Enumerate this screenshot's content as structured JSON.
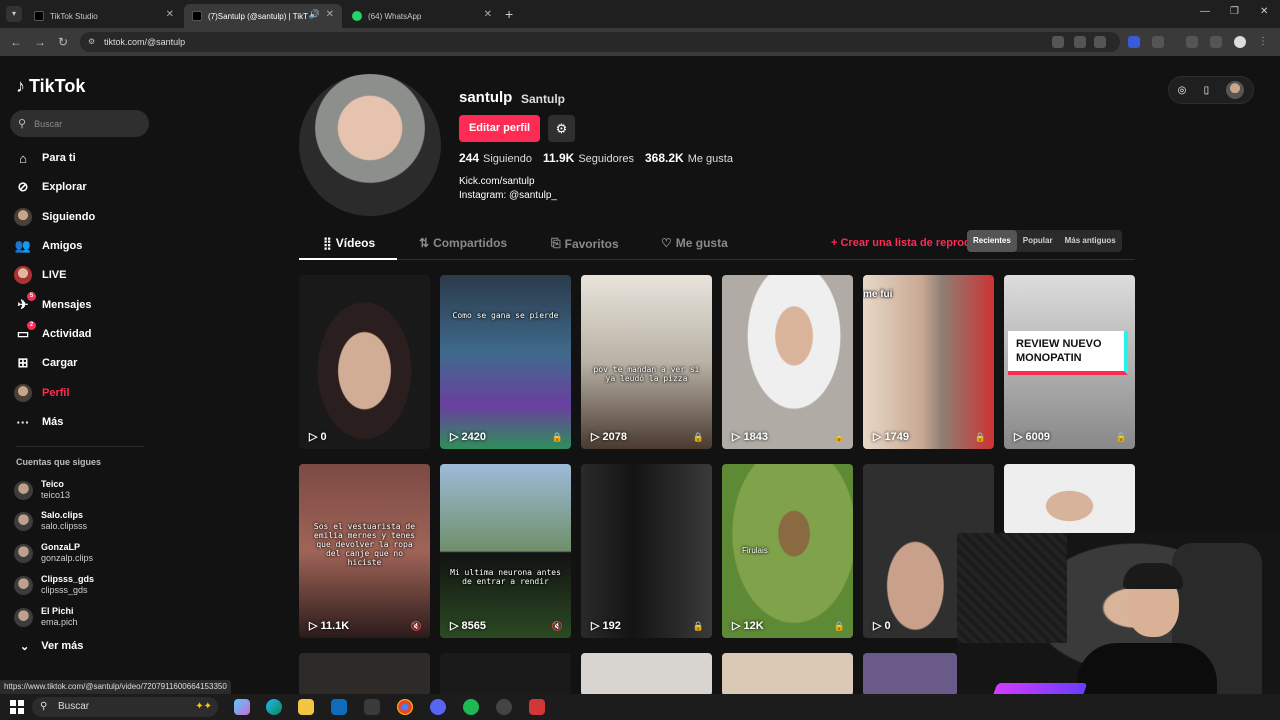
{
  "browser": {
    "tabs": [
      {
        "title": "TikTok Studio"
      },
      {
        "title": "(7)Santulp (@santulp) | TikT"
      },
      {
        "title": "(64) WhatsApp"
      }
    ],
    "url": "tiktok.com/@santulp",
    "status_url": "https://www.tiktok.com/@santulp/video/7207911600664153350"
  },
  "sidebar": {
    "brand": "TikTok",
    "search_placeholder": "Buscar",
    "items": [
      {
        "label": "Para ti",
        "icon": "home-icon"
      },
      {
        "label": "Explorar",
        "icon": "compass-icon"
      },
      {
        "label": "Siguiendo",
        "icon": "following-avatar-icon"
      },
      {
        "label": "Amigos",
        "icon": "friends-icon"
      },
      {
        "label": "LIVE",
        "icon": "live-icon"
      },
      {
        "label": "Mensajes",
        "icon": "messages-icon",
        "badge": "5"
      },
      {
        "label": "Actividad",
        "icon": "activity-icon",
        "badge": "2"
      },
      {
        "label": "Cargar",
        "icon": "upload-icon"
      },
      {
        "label": "Perfil",
        "icon": "profile-avatar-icon"
      },
      {
        "label": "Más",
        "icon": "more-icon"
      }
    ],
    "following_title": "Cuentas que sigues",
    "following": [
      {
        "name": "Teico",
        "handle": "teico13"
      },
      {
        "name": "Salo.clips",
        "handle": "salo.clipsss"
      },
      {
        "name": "GonzaLP",
        "handle": "gonzalp.clips"
      },
      {
        "name": "Clipsss_gds",
        "handle": "clipsss_gds"
      },
      {
        "name": "El Pichi",
        "handle": "ema.pich"
      }
    ],
    "see_more": "Ver más"
  },
  "profile": {
    "username": "santulp",
    "nickname": "Santulp",
    "edit_label": "Editar perfil",
    "following_count": "244",
    "following_label": "Siguiendo",
    "followers_count": "11.9K",
    "followers_label": "Seguidores",
    "likes_count": "368.2K",
    "likes_label": "Me gusta",
    "bio_line1": "Kick.com/santulp",
    "bio_line2": "Instagram: @santulp_"
  },
  "tabs": {
    "videos": "Vídeos",
    "shared": "Compartidos",
    "favorites": "Favoritos",
    "liked": "Me gusta",
    "create_playlist": "Crear una lista de reproducción"
  },
  "sort": {
    "options": [
      "Recientes",
      "Popular",
      "Más antiguos"
    ],
    "selected": "Recientes"
  },
  "videos": [
    {
      "views": "0",
      "caption": ""
    },
    {
      "views": "2420",
      "caption": "Como se gana se pierde"
    },
    {
      "views": "2078",
      "caption": "pov te mandan a ver si ya leudó la pizza"
    },
    {
      "views": "1843",
      "caption": ""
    },
    {
      "views": "1749",
      "caption": "me fui"
    },
    {
      "views": "6009",
      "caption": "REVIEW NUEVO MONOPATIN"
    },
    {
      "views": "11.1K",
      "caption": "Sos el vestuarista de emilia mernes y tenes que devolver la ropa del canje que no hiciste"
    },
    {
      "views": "8565",
      "caption": "Mi ultima neurona antes de entrar a rendir"
    },
    {
      "views": "192",
      "caption": ""
    },
    {
      "views": "12K",
      "caption": "Firulais"
    },
    {
      "views": "0",
      "caption": ""
    }
  ],
  "taskbar": {
    "search": "Buscar"
  },
  "colors": {
    "accent": "#fe2c55",
    "background": "#121212"
  }
}
